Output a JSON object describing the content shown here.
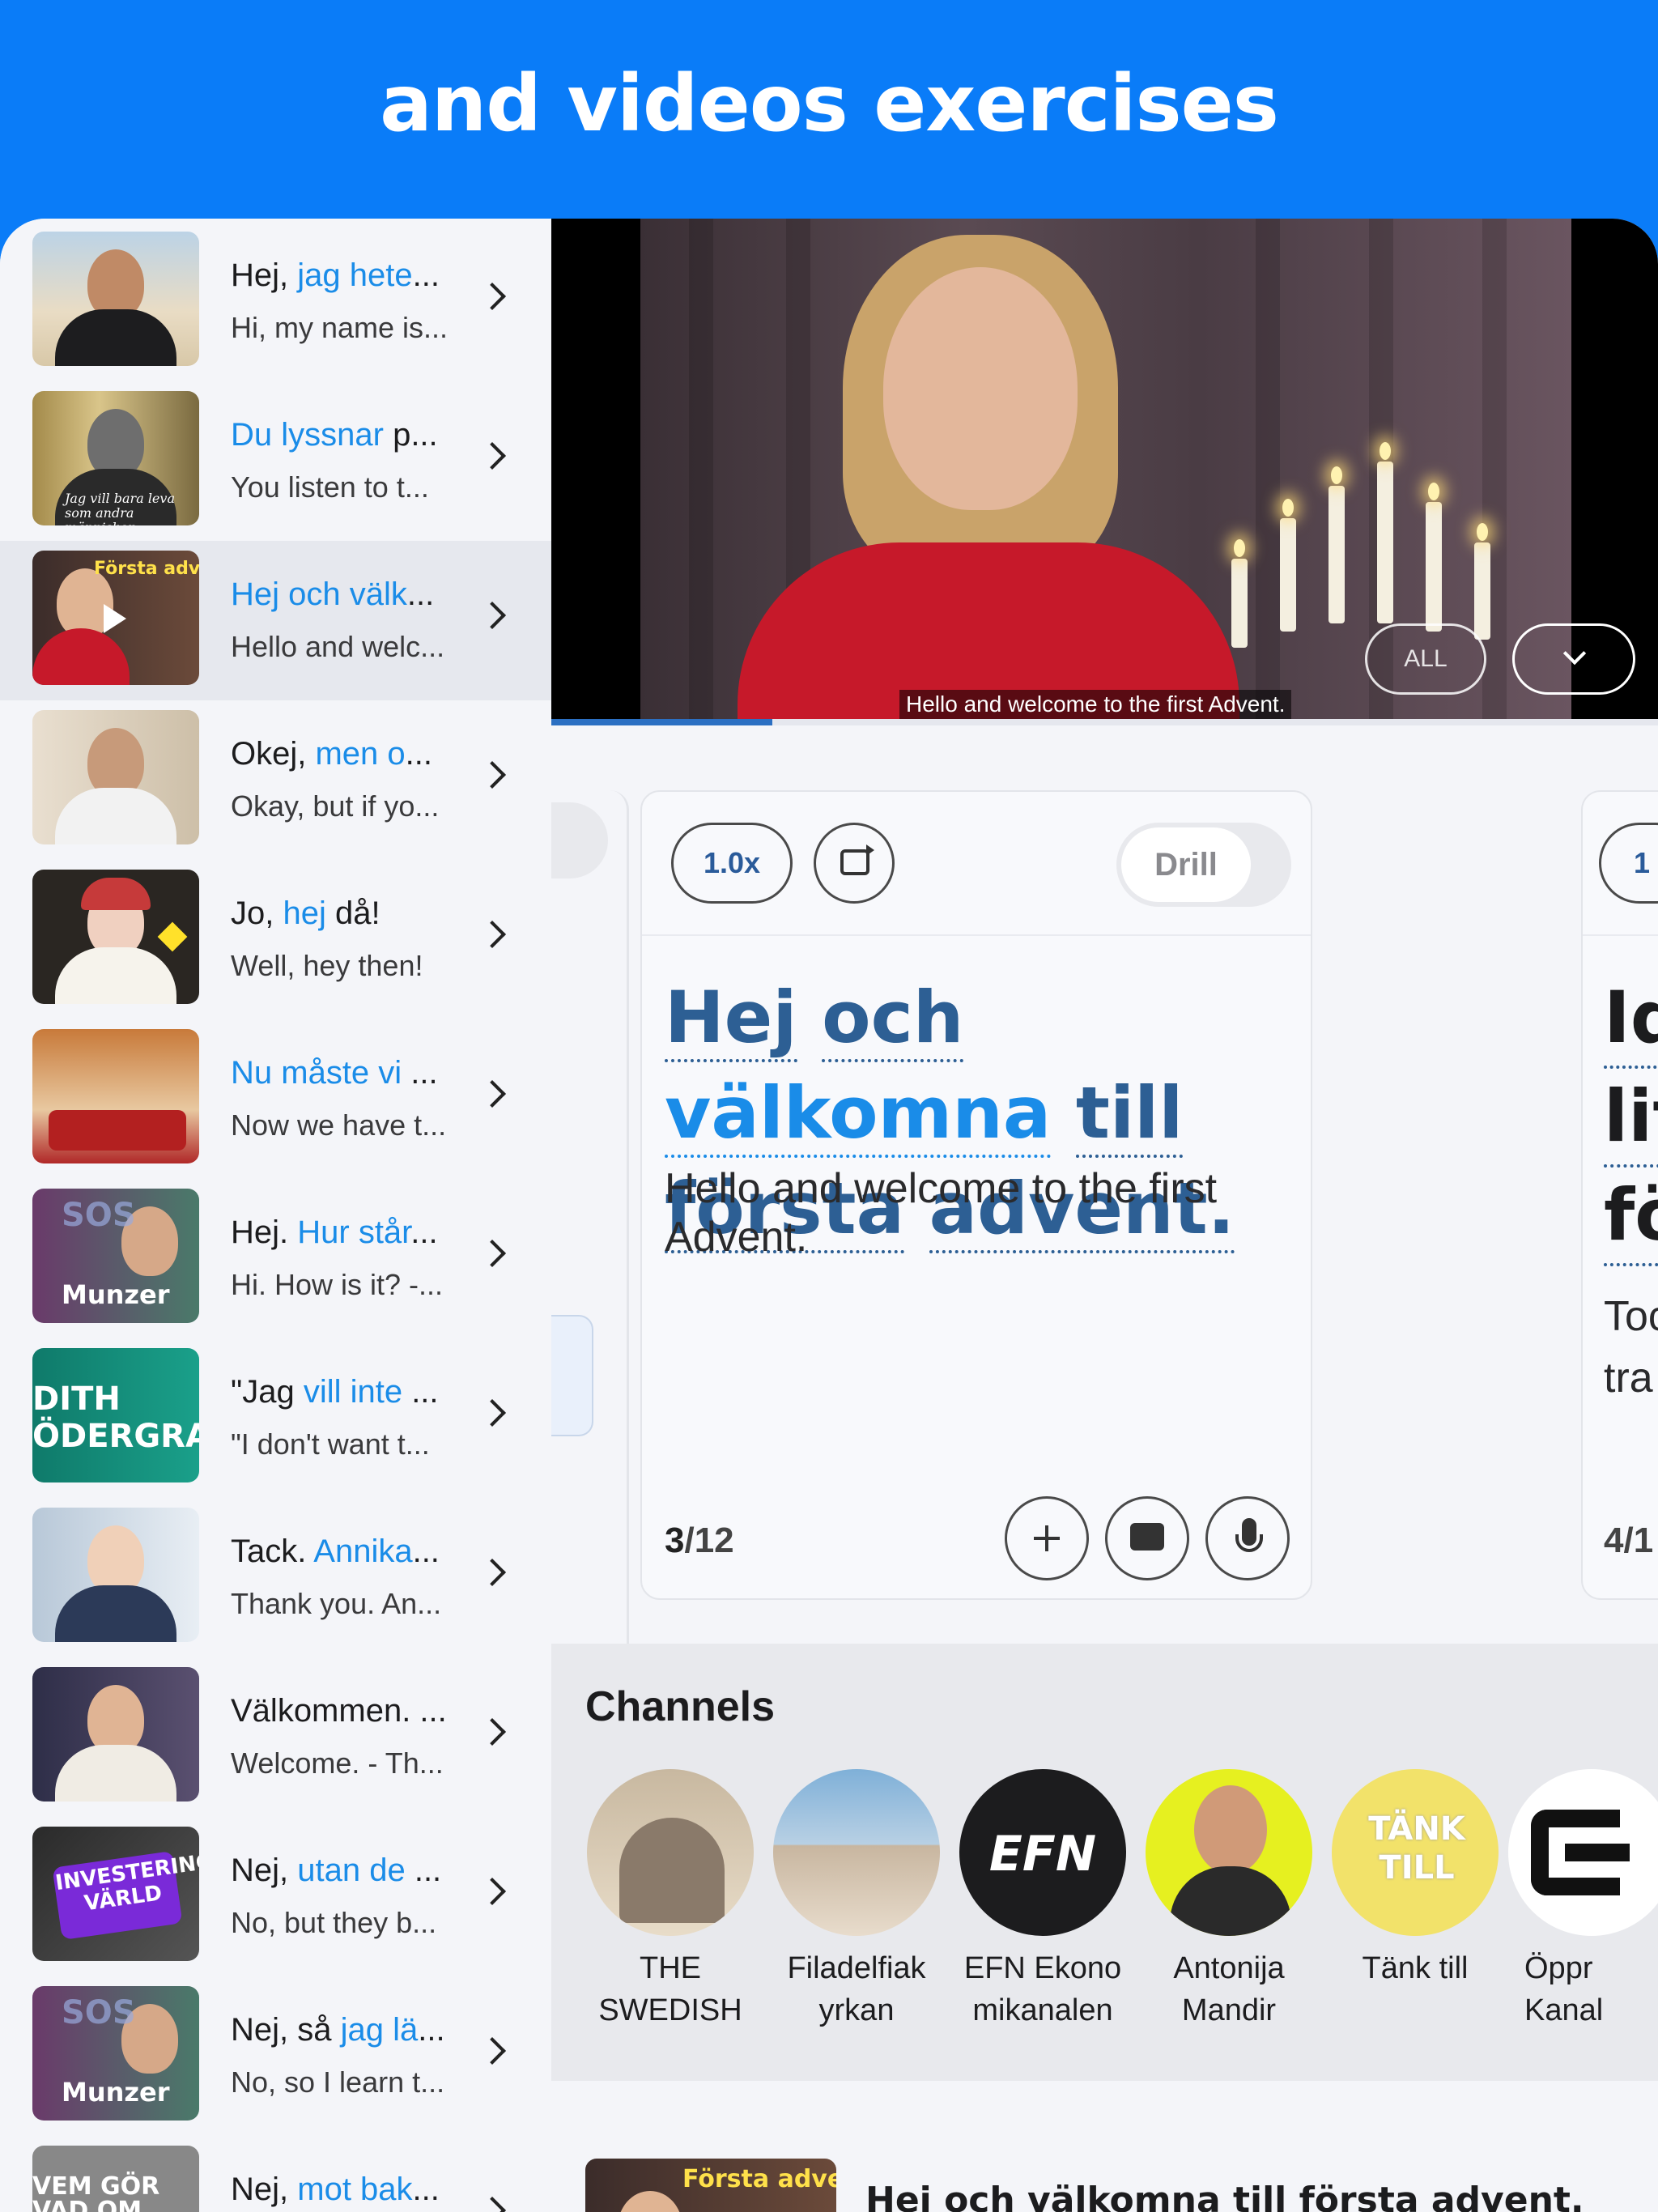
{
  "banner": {
    "title": "and videos exercises"
  },
  "list": [
    {
      "pre": "Hej, ",
      "hl": "jag hete",
      "post": "...",
      "sub": "Hi, my name is..."
    },
    {
      "pre": "",
      "hl": "Du lyssnar",
      "post": " p...",
      "sub": "You listen to t...",
      "overlay": "Jag vill bara leva som andra människor"
    },
    {
      "pre": "",
      "hl": "Hej och välk",
      "post": "...",
      "sub": "Hello and welc...",
      "overlay": "Första advent"
    },
    {
      "pre": "Okej, ",
      "hl": "men o",
      "post": "...",
      "sub": "Okay, but if yo..."
    },
    {
      "pre": "Jo, ",
      "hl": "hej",
      "post": " då!",
      "sub": "Well, hey then!"
    },
    {
      "pre": "",
      "hl": "Nu måste vi",
      "post": " ...",
      "sub": "Now we have t..."
    },
    {
      "pre": "Hej. ",
      "hl": "Hur står",
      "post": "...",
      "sub": "Hi. How is it? -...",
      "overlay": "Munzer"
    },
    {
      "pre": "\"Jag ",
      "hl": "vill inte",
      "post": " ...",
      "sub": "\"I don't want t...",
      "overlay": "DITH ÖDERGRA"
    },
    {
      "pre": "Tack. ",
      "hl": "Annika",
      "post": "...",
      "sub": "Thank you. An..."
    },
    {
      "pre": "Välkommen. ...",
      "hl": "",
      "post": "",
      "sub": "Welcome. - Th..."
    },
    {
      "pre": "Nej, ",
      "hl": "utan de",
      "post": " ...",
      "sub": "No, but they b...",
      "overlay": "INVESTERINGARNAS VÄRLD"
    },
    {
      "pre": "Nej, så ",
      "hl": "jag lä",
      "post": "...",
      "sub": "No, so I learn t...",
      "overlay": "Munzer"
    },
    {
      "pre": "Nej, ",
      "hl": "mot bak",
      "post": "...",
      "sub": "",
      "overlay": "VEM GÖR VAD OM NÅGON BLI"
    }
  ],
  "video": {
    "subtitle": "Hello and welcome to the first Advent.",
    "all_label": "ALL",
    "progress": 0.2
  },
  "card": {
    "speed": "1.0x",
    "drill": "Drill",
    "swedish": [
      {
        "text": "Hej",
        "hl": false
      },
      {
        "text": "och",
        "hl": false
      },
      {
        "text": "välkomna",
        "hl": true
      },
      {
        "text": "till",
        "hl": false
      },
      {
        "text": "första",
        "hl": false
      },
      {
        "text": "advent.",
        "hl": false
      }
    ],
    "english": "Hello and welcome to the first Advent.",
    "index": "3",
    "total": "/12"
  },
  "next_card": {
    "speed": "1",
    "lines": [
      "Id",
      "lit",
      "fö"
    ],
    "eng": [
      "Toc",
      "tra"
    ],
    "count": "4/1"
  },
  "channels": {
    "title": "Channels",
    "items": [
      {
        "line1": "THE",
        "line2": "SWEDISH",
        "color": "#c9b49a"
      },
      {
        "line1": "Filadelfiak",
        "line2": "yrkan",
        "color": "#7fa6c8"
      },
      {
        "line1": "EFN Ekono",
        "line2": "mikanalen",
        "color": "#1c1c1e",
        "logo": "EFN"
      },
      {
        "line1": "Antonija",
        "line2": "Mandir",
        "color": "#e6f020"
      },
      {
        "line1": "Tänk till",
        "line2": "",
        "color": "#f2e26a",
        "logo": "TÄNK TILL"
      },
      {
        "line1": "Öppr",
        "line2": "Kanal",
        "color": "#ffffff"
      }
    ]
  },
  "bottom": {
    "overlay": "Första adver",
    "title": "Hej och välkomna till första advent."
  }
}
